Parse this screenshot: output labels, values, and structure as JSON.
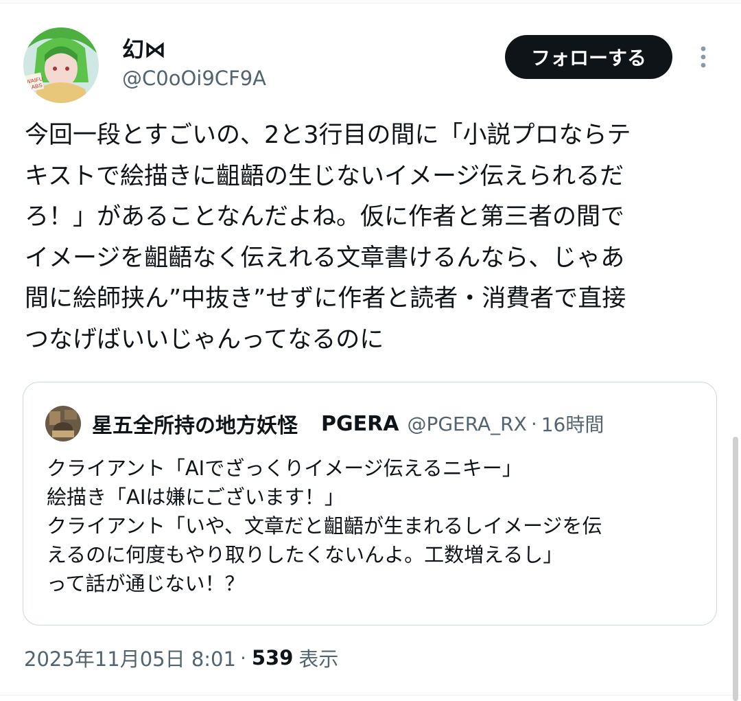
{
  "tweet": {
    "author": {
      "display_name": "幻⋈",
      "handle": "@C0oOi9CF9A"
    },
    "follow_label": "フォローする",
    "text": "今回一段とすごいの、2と3行目の間に「小説プロならテ\nキストで絵描きに齟齬の生じないイメージ伝えられるだ\nろ！」があることなんだよね。仮に作者と第三者の間で\nイメージを齟齬なく伝えれる文章書けるんなら、じゃあ\n間に絵師挟ん”中抜き”せずに作者と読者・消費者で直接\nつなげばいいじゃんってなるのに",
    "quoted": {
      "display_name": "星五全所持の地方妖怪",
      "handle_name": "PGERA",
      "handle": "@PGERA_RX",
      "separator": "·",
      "time": "16時間",
      "text": "クライアント「AIでざっくりイメージ伝えるニキー」\n絵描き「AIは嫌にございます！」\nクライアント「いや、文章だと齟齬が生まれるしイメージを伝\nえるのに何度もやり取りしたくないんよ。工数増えるし」\nって話が通じない！？"
    },
    "meta": {
      "datetime": "2025年11月05日 8:01",
      "separator": "·",
      "views_count": "539",
      "views_label": "表示"
    }
  },
  "icons": {
    "more": "more-dots-icon"
  },
  "colors": {
    "text": "#0f1419",
    "secondary": "#536471",
    "border": "#cfd9de",
    "button_bg": "#0f1419"
  }
}
